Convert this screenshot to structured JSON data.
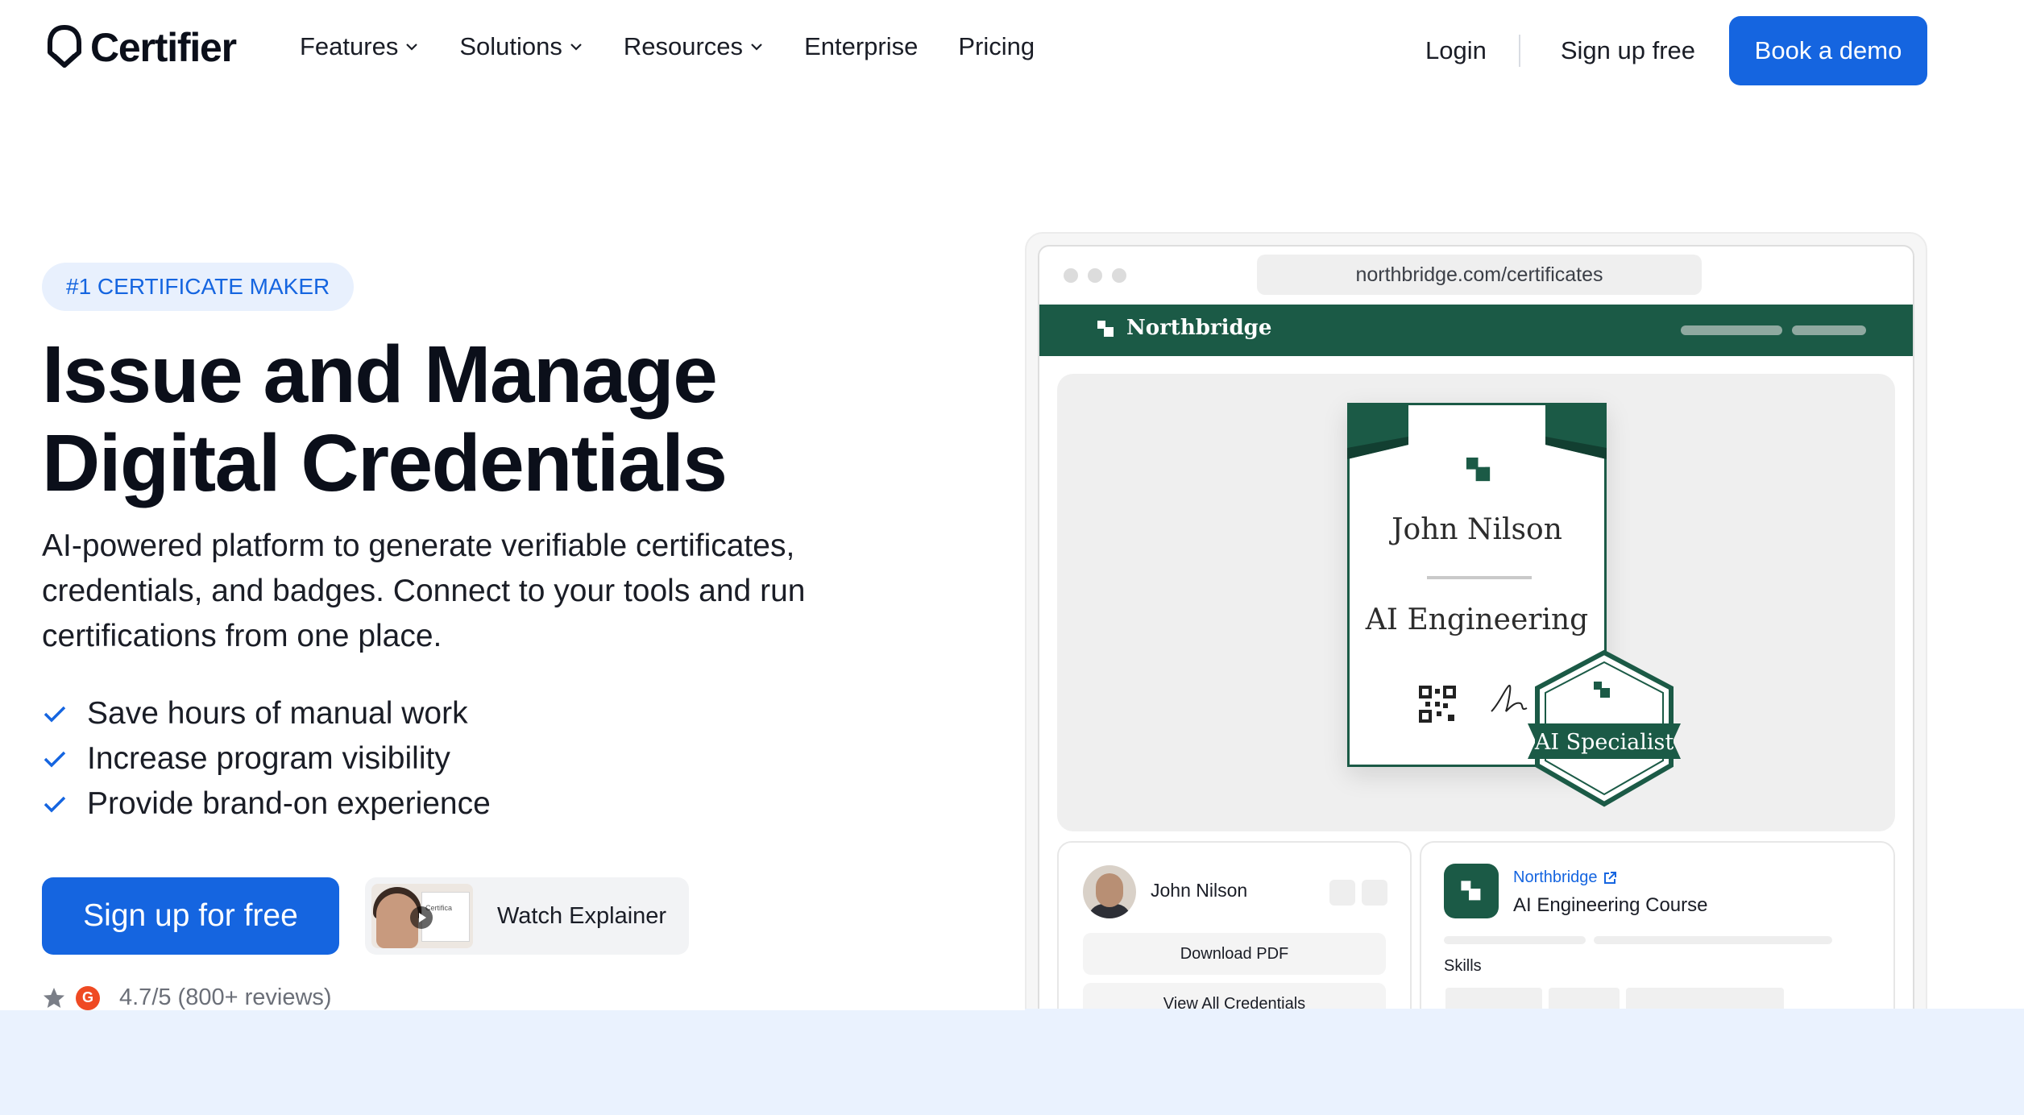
{
  "nav": {
    "brand": "Certifier",
    "links": [
      {
        "label": "Features",
        "dropdown": true
      },
      {
        "label": "Solutions",
        "dropdown": true
      },
      {
        "label": "Resources",
        "dropdown": true
      },
      {
        "label": "Enterprise",
        "dropdown": false
      },
      {
        "label": "Pricing",
        "dropdown": false
      }
    ],
    "login": "Login",
    "signup": "Sign up free",
    "demo": "Book a demo"
  },
  "hero": {
    "badge": "#1 CERTIFICATE MAKER",
    "title_line1": "Issue and Manage",
    "title_line2": "Digital Credentials",
    "description": "AI-powered platform to generate verifiable certificates, credentials, and badges. Connect to your tools and run certifications from one place.",
    "checks": [
      "Save hours of manual work",
      "Increase program visibility",
      "Provide brand-on experience"
    ],
    "cta": "Sign up for free",
    "explainer": "Watch Explainer",
    "explainer_thumb_text": "Certifica",
    "rating": "4.7/5 (800+ reviews)",
    "g2_label": "G"
  },
  "mockup": {
    "url": "northbridge.com/certificates",
    "org": "Northbridge",
    "certificate": {
      "recipient": "John Nilson",
      "course": "AI Engineering",
      "seal_label": "AI Specialist"
    },
    "holder_card": {
      "name": "John Nilson",
      "download": "Download PDF",
      "view_all": "View All Credentials"
    },
    "course_card": {
      "org": "Northbridge",
      "course": "AI Engineering Course",
      "skills_label": "Skills"
    }
  },
  "colors": {
    "accent": "#1565e0",
    "brand_green": "#1b5a46",
    "band": "#eaf2fe",
    "badge_bg": "#e8f0fd"
  },
  "icons": {
    "chevron": "chevron-down-icon",
    "check": "check-icon",
    "star": "star-icon",
    "external": "external-link-icon"
  }
}
